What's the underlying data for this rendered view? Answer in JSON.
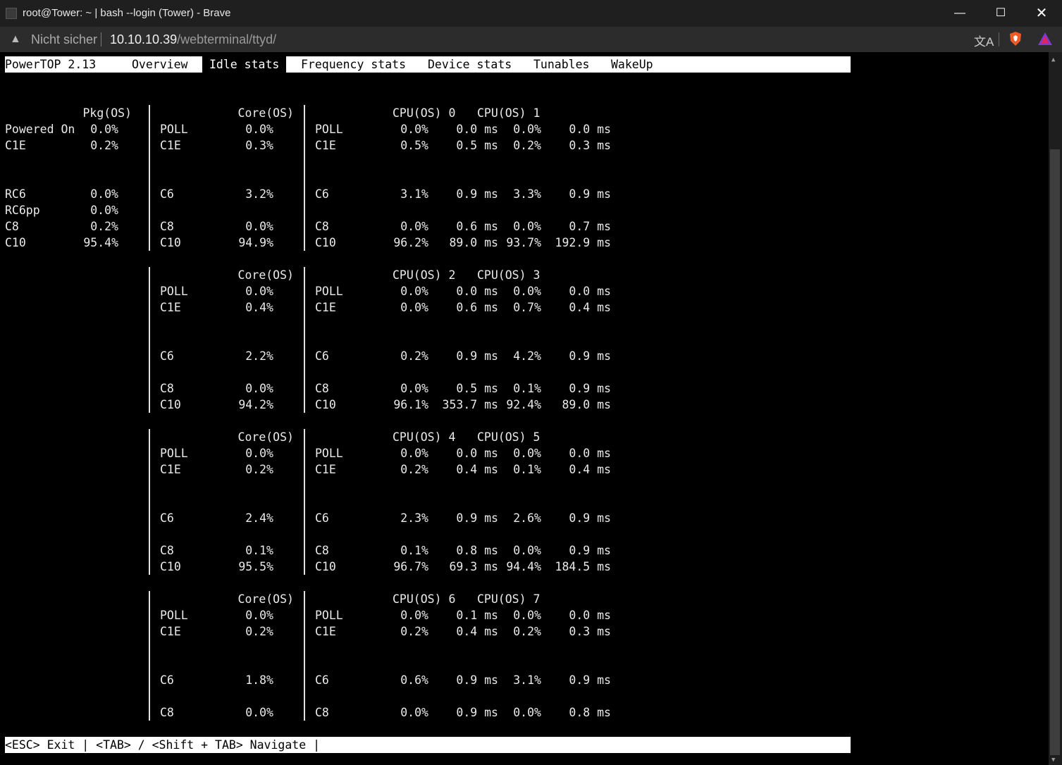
{
  "window": {
    "title": "root@Tower: ~ | bash --login (Tower) - Brave",
    "minimize_glyph": "—",
    "maximize_glyph": "☐",
    "close_glyph": "✕"
  },
  "addressbar": {
    "security_label": "Nicht sicher",
    "url_host": "10.10.10.39",
    "url_path": "/webterminal/ttyd/",
    "translate_glyph": "文A",
    "warning_glyph": "▲"
  },
  "powertop": {
    "tabs": [
      {
        "label": "PowerTOP 2.13"
      },
      {
        "label": "Overview"
      },
      {
        "label": "Idle stats"
      },
      {
        "label": "Frequency stats"
      },
      {
        "label": "Device stats"
      },
      {
        "label": "Tunables"
      },
      {
        "label": "WakeUp"
      }
    ],
    "active_tab": "Idle stats",
    "status_bar": "<ESC> Exit | <TAB> / <Shift + TAB> Navigate |",
    "pkg": {
      "header": "Pkg(OS)",
      "rows": [
        {
          "state": "Powered On",
          "pct": "0.0%",
          "row": 1
        },
        {
          "state": "C1E",
          "pct": "0.2%",
          "row": 2
        },
        {
          "state": "RC6",
          "pct": "0.0%",
          "row": 5
        },
        {
          "state": "RC6pp",
          "pct": "0.0%",
          "row": 6
        },
        {
          "state": "C8",
          "pct": "0.2%",
          "row": 7
        },
        {
          "state": "C10",
          "pct": "95.4%",
          "row": 8
        }
      ]
    },
    "blocks": [
      {
        "core_header": "Core(OS)",
        "cpu_a_header": "CPU(OS) 0",
        "cpu_b_header": "CPU(OS) 1",
        "sep_rows": [
          0,
          1,
          2,
          3,
          4,
          5,
          6,
          7,
          8
        ],
        "rows": [
          {
            "row": 1,
            "core_state": "POLL",
            "core_pct": "0.0%",
            "cpu_state": "POLL",
            "a_pct": "0.0%",
            "a_ms": "0.0 ms",
            "b_pct": "0.0%",
            "b_ms": "0.0 ms"
          },
          {
            "row": 2,
            "core_state": "C1E",
            "core_pct": "0.3%",
            "cpu_state": "C1E",
            "a_pct": "0.5%",
            "a_ms": "0.5 ms",
            "b_pct": "0.2%",
            "b_ms": "0.3 ms"
          },
          {
            "row": 5,
            "core_state": "C6",
            "core_pct": "3.2%",
            "cpu_state": "C6",
            "a_pct": "3.1%",
            "a_ms": "0.9 ms",
            "b_pct": "3.3%",
            "b_ms": "0.9 ms"
          },
          {
            "row": 7,
            "core_state": "C8",
            "core_pct": "0.0%",
            "cpu_state": "C8",
            "a_pct": "0.0%",
            "a_ms": "0.6 ms",
            "b_pct": "0.0%",
            "b_ms": "0.7 ms"
          },
          {
            "row": 8,
            "core_state": "C10",
            "core_pct": "94.9%",
            "cpu_state": "C10",
            "a_pct": "96.2%",
            "a_ms": "89.0 ms",
            "b_pct": "93.7%",
            "b_ms": "192.9 ms"
          }
        ]
      },
      {
        "core_header": "Core(OS)",
        "cpu_a_header": "CPU(OS) 2",
        "cpu_b_header": "CPU(OS) 3",
        "sep_rows": [
          0,
          1,
          2,
          3,
          4,
          5,
          6,
          7,
          8
        ],
        "rows": [
          {
            "row": 1,
            "core_state": "POLL",
            "core_pct": "0.0%",
            "cpu_state": "POLL",
            "a_pct": "0.0%",
            "a_ms": "0.0 ms",
            "b_pct": "0.0%",
            "b_ms": "0.0 ms"
          },
          {
            "row": 2,
            "core_state": "C1E",
            "core_pct": "0.4%",
            "cpu_state": "C1E",
            "a_pct": "0.0%",
            "a_ms": "0.6 ms",
            "b_pct": "0.7%",
            "b_ms": "0.4 ms"
          },
          {
            "row": 5,
            "core_state": "C6",
            "core_pct": "2.2%",
            "cpu_state": "C6",
            "a_pct": "0.2%",
            "a_ms": "0.9 ms",
            "b_pct": "4.2%",
            "b_ms": "0.9 ms"
          },
          {
            "row": 7,
            "core_state": "C8",
            "core_pct": "0.0%",
            "cpu_state": "C8",
            "a_pct": "0.0%",
            "a_ms": "0.5 ms",
            "b_pct": "0.1%",
            "b_ms": "0.9 ms"
          },
          {
            "row": 8,
            "core_state": "C10",
            "core_pct": "94.2%",
            "cpu_state": "C10",
            "a_pct": "96.1%",
            "a_ms": "353.7 ms",
            "b_pct": "92.4%",
            "b_ms": "89.0 ms"
          }
        ]
      },
      {
        "core_header": "Core(OS)",
        "cpu_a_header": "CPU(OS) 4",
        "cpu_b_header": "CPU(OS) 5",
        "sep_rows": [
          0,
          1,
          2,
          3,
          4,
          5,
          6,
          7,
          8
        ],
        "rows": [
          {
            "row": 1,
            "core_state": "POLL",
            "core_pct": "0.0%",
            "cpu_state": "POLL",
            "a_pct": "0.0%",
            "a_ms": "0.0 ms",
            "b_pct": "0.0%",
            "b_ms": "0.0 ms"
          },
          {
            "row": 2,
            "core_state": "C1E",
            "core_pct": "0.2%",
            "cpu_state": "C1E",
            "a_pct": "0.2%",
            "a_ms": "0.4 ms",
            "b_pct": "0.1%",
            "b_ms": "0.4 ms"
          },
          {
            "row": 5,
            "core_state": "C6",
            "core_pct": "2.4%",
            "cpu_state": "C6",
            "a_pct": "2.3%",
            "a_ms": "0.9 ms",
            "b_pct": "2.6%",
            "b_ms": "0.9 ms"
          },
          {
            "row": 7,
            "core_state": "C8",
            "core_pct": "0.1%",
            "cpu_state": "C8",
            "a_pct": "0.1%",
            "a_ms": "0.8 ms",
            "b_pct": "0.0%",
            "b_ms": "0.9 ms"
          },
          {
            "row": 8,
            "core_state": "C10",
            "core_pct": "95.5%",
            "cpu_state": "C10",
            "a_pct": "96.7%",
            "a_ms": "69.3 ms",
            "b_pct": "94.4%",
            "b_ms": "184.5 ms"
          }
        ]
      },
      {
        "core_header": "Core(OS)",
        "cpu_a_header": "CPU(OS) 6",
        "cpu_b_header": "CPU(OS) 7",
        "sep_rows": [
          0,
          1,
          2,
          3,
          4,
          5,
          6,
          7
        ],
        "rows": [
          {
            "row": 1,
            "core_state": "POLL",
            "core_pct": "0.0%",
            "cpu_state": "POLL",
            "a_pct": "0.0%",
            "a_ms": "0.1 ms",
            "b_pct": "0.0%",
            "b_ms": "0.0 ms"
          },
          {
            "row": 2,
            "core_state": "C1E",
            "core_pct": "0.2%",
            "cpu_state": "C1E",
            "a_pct": "0.2%",
            "a_ms": "0.4 ms",
            "b_pct": "0.2%",
            "b_ms": "0.3 ms"
          },
          {
            "row": 5,
            "core_state": "C6",
            "core_pct": "1.8%",
            "cpu_state": "C6",
            "a_pct": "0.6%",
            "a_ms": "0.9 ms",
            "b_pct": "3.1%",
            "b_ms": "0.9 ms"
          },
          {
            "row": 7,
            "core_state": "C8",
            "core_pct": "0.0%",
            "cpu_state": "C8",
            "a_pct": "0.0%",
            "a_ms": "0.9 ms",
            "b_pct": "0.0%",
            "b_ms": "0.8 ms"
          }
        ]
      }
    ]
  }
}
